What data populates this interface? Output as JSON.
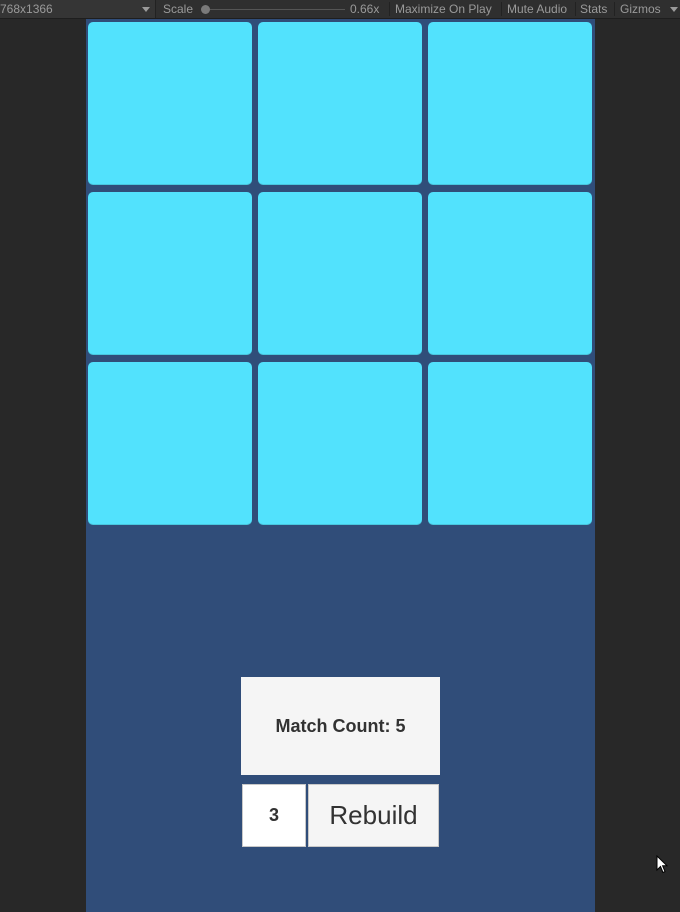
{
  "toolbar": {
    "resolution": "768x1366",
    "scale_label": "Scale",
    "scale_value": "0.66x",
    "scale_fraction": 0.0,
    "maximize_label": "Maximize On Play",
    "mute_label": "Mute Audio",
    "stats_label": "Stats",
    "gizmos_label": "Gizmos"
  },
  "game": {
    "background_color": "#304d79",
    "tile_color": "#52e2fd",
    "grid_rows": 3,
    "grid_cols": 3,
    "tiles": [
      "",
      "",
      "",
      "",
      "",
      "",
      "",
      "",
      ""
    ],
    "match_count_text": "Match Count: 5",
    "size_input_value": "3",
    "rebuild_label": "Rebuild"
  }
}
